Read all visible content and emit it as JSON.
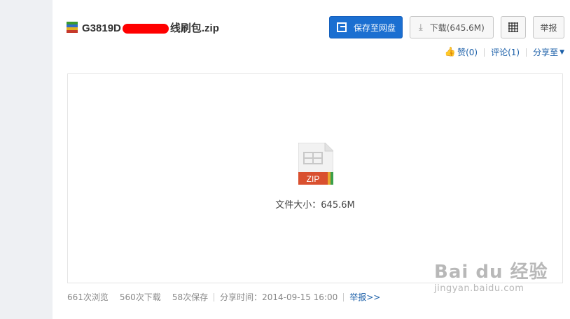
{
  "file": {
    "title_prefix": "G3819D",
    "title_suffix": "线刷包.zip",
    "icon": "archive-icon"
  },
  "toolbar": {
    "save_label": "保存至网盘",
    "download_label": "下载(645.6M)",
    "report_label": "举报"
  },
  "actions": {
    "like_label": "赞(0)",
    "comment_label": "评论(1)",
    "share_label": "分享至"
  },
  "preview": {
    "badge": "ZIP",
    "size_text": "文件大小：645.6M"
  },
  "stats": {
    "views": "661次浏览",
    "downloads": "560次下载",
    "saves": "58次保存",
    "share_time": "分享时间：2014-09-15 16:00",
    "report_link": "举报>>"
  },
  "watermark": {
    "brand": "Bai du 经验",
    "url": "jingyan.baidu.com"
  },
  "colors": {
    "primary": "#1b6fd1",
    "link": "#1b5fa8",
    "zip_badge": "#d9502f"
  }
}
